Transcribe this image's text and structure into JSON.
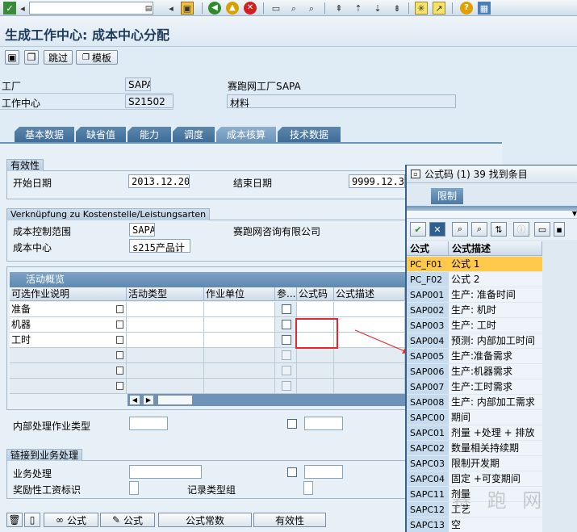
{
  "title": "生成工作中心: 成本中心分配",
  "toolbar": {
    "command_value": "",
    "icons": [
      "save-icon",
      "back-icon",
      "exit-icon",
      "cancel-icon",
      "print-icon",
      "find-icon",
      "find-next-icon",
      "first-page-icon",
      "prev-page-icon",
      "next-page-icon",
      "last-page-icon",
      "new-session-icon",
      "shortcut-icon",
      "help-icon",
      "customize-icon"
    ]
  },
  "app_toolbar": {
    "skip_label": "跳过",
    "template_label": "模板"
  },
  "header": {
    "plant_label": "工厂",
    "plant_value": "SAPA",
    "plant_desc": "赛跑网工厂SAPA",
    "workcenter_label": "工作中心",
    "workcenter_value": "S21502",
    "workcenter_desc": "材料"
  },
  "tabs": [
    "基本数据",
    "缺省值",
    "能力",
    "调度",
    "成本核算",
    "技术数据"
  ],
  "active_tab": "成本核算",
  "validity": {
    "title": "有效性",
    "start_label": "开始日期",
    "start_value": "2013.12.20",
    "end_label": "结束日期",
    "end_value": "9999.12.3"
  },
  "link": {
    "title": "Verknüpfung zu Kostenstelle/Leistungsarten",
    "area_label": "成本控制范围",
    "area_value": "SAPA",
    "area_desc": "赛跑网咨询有限公司",
    "cc_label": "成本中心",
    "cc_value": "s215产品计"
  },
  "activities": {
    "title": "活动概览",
    "columns": [
      "可选作业说明",
      "活动类型",
      "作业单位",
      "参...",
      "公式码",
      "公式描述"
    ],
    "rows": [
      {
        "desc": "准备"
      },
      {
        "desc": "机器"
      },
      {
        "desc": "工时"
      },
      {
        "desc": ""
      },
      {
        "desc": ""
      },
      {
        "desc": ""
      }
    ]
  },
  "internal_label": "内部处理作业类型",
  "business": {
    "title": "链接到业务处理",
    "process_label": "业务处理",
    "incentive_label": "奖励性工资标识",
    "record_label": "记录类型组"
  },
  "bottom_buttons": {
    "formula1": "公式",
    "formula2": "公式",
    "constants": "公式常数",
    "validity": "有效性"
  },
  "popup": {
    "title": "公式码 (1)  39 找到条目",
    "tab_label": "限制",
    "col_code": "公式",
    "col_desc": "公式描述",
    "rows": [
      {
        "code": "PC_F01",
        "desc": "公式 1"
      },
      {
        "code": "PC_F02",
        "desc": "公式 2"
      },
      {
        "code": "SAP001",
        "desc": "生产: 准备时间"
      },
      {
        "code": "SAP002",
        "desc": "生产: 机时"
      },
      {
        "code": "SAP003",
        "desc": "生产: 工时"
      },
      {
        "code": "SAP004",
        "desc": "预测: 内部加工时间"
      },
      {
        "code": "SAP005",
        "desc": "生产:准备需求"
      },
      {
        "code": "SAP006",
        "desc": "生产:机器需求"
      },
      {
        "code": "SAP007",
        "desc": "生产:工时需求"
      },
      {
        "code": "SAP008",
        "desc": "生产: 内部加工需求"
      },
      {
        "code": "SAPC00",
        "desc": "期间"
      },
      {
        "code": "SAPC01",
        "desc": "剂量 +处理 + 排放"
      },
      {
        "code": "SAPC02",
        "desc": "数量相关持续期"
      },
      {
        "code": "SAPC03",
        "desc": "限制开发期"
      },
      {
        "code": "SAPC04",
        "desc": "固定 +可变期间"
      },
      {
        "code": "SAPC11",
        "desc": "剂量"
      },
      {
        "code": "SAPC12",
        "desc": "工艺"
      },
      {
        "code": "SAPC13",
        "desc": "空"
      }
    ]
  },
  "watermark": "赛 跑 网",
  "colors": {
    "accent": "#3f6d98",
    "highlight": "#ffc94b",
    "annotation": "#e8262a"
  }
}
